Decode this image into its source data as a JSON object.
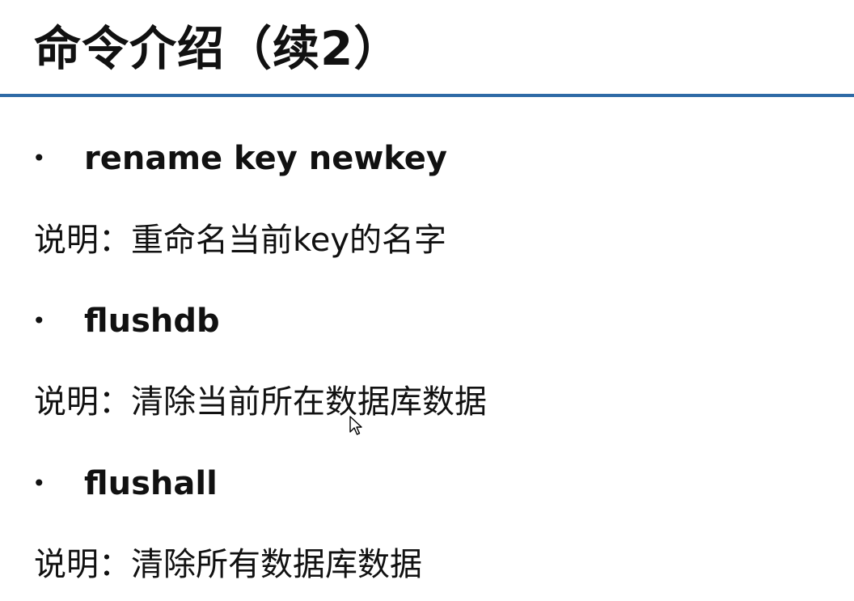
{
  "title": "命令介绍（续2）",
  "items": [
    {
      "command": "rename key newkey",
      "description": "说明：重命名当前key的名字"
    },
    {
      "command": "flushdb",
      "description": "说明：清除当前所在数据库数据"
    },
    {
      "command": "flushall",
      "description": "说明：清除所有数据库数据"
    }
  ],
  "colors": {
    "rule": "#2e6aa6",
    "text": "#111111"
  },
  "icons": {
    "bullet": "bullet-dot-icon",
    "pointer": "mouse-pointer-icon"
  }
}
